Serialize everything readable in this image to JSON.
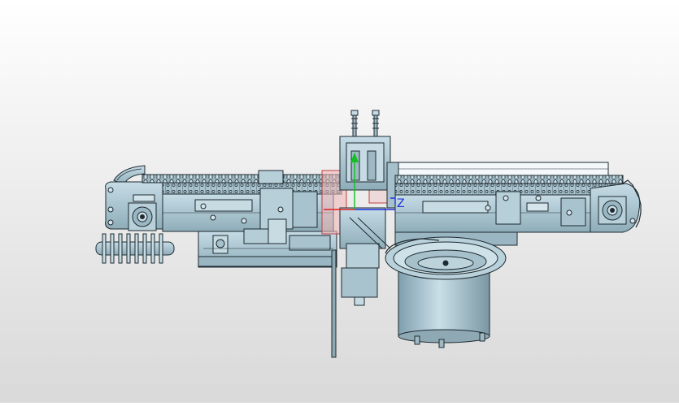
{
  "viewport": {
    "triad": {
      "z_label": "Z",
      "x_color": "#e02020",
      "y_color": "#10c020",
      "z_color": "#2030e0"
    },
    "colors": {
      "steel": "#a7c3cf",
      "steel_dark": "#7f9eab",
      "outline": "#1e2a30",
      "highlight": "#ffffff",
      "selection": "#f1b7b7"
    },
    "model": {
      "icon": "cad-assembly-icon"
    }
  }
}
